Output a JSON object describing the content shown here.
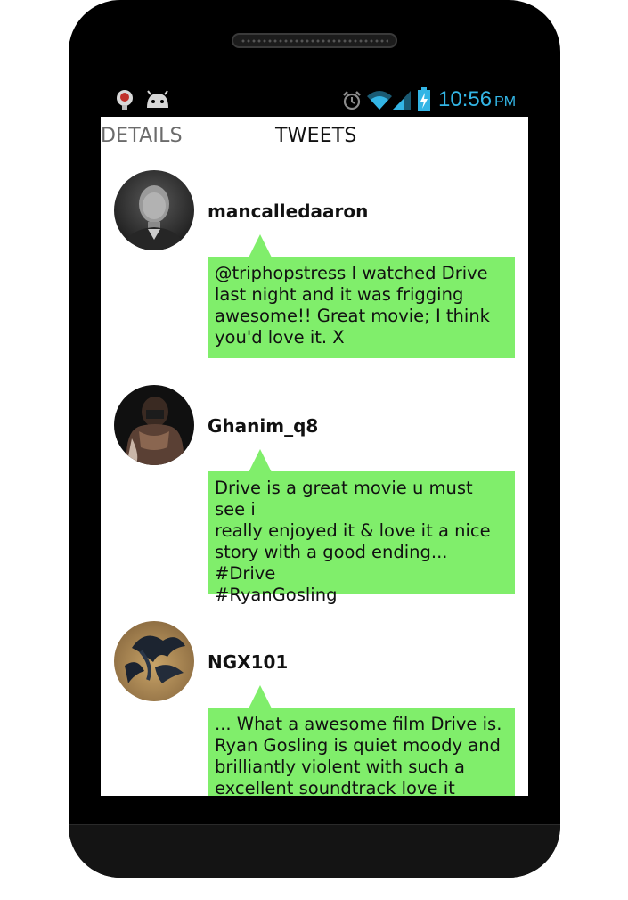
{
  "status_bar": {
    "left_icons": [
      "notification-app-icon",
      "android-debug-icon"
    ],
    "right_icons": [
      "alarm-icon",
      "wifi-icon",
      "signal-icon",
      "battery-charging-icon"
    ],
    "time": "10:56",
    "ampm": "PM",
    "accent_color": "#33b5e5"
  },
  "tabs": [
    {
      "label": "DETAILS"
    },
    {
      "label": "TWEETS"
    }
  ],
  "tweets": [
    {
      "username": "mancalledaaron",
      "text": "@triphopstress I watched Drive\nlast night and it was frigging\nawesome!! Great movie; I think\nyou'd love it. X"
    },
    {
      "username": "Ghanim_q8",
      "text": "Drive is a great movie u must see i\nreally enjoyed it & love it a nice\nstory with a good ending...\n#Drive\n#RyanGosling"
    },
    {
      "username": "NGX101",
      "text": "... What a awesome film Drive is.\nRyan Gosling is quiet moody and\nbrilliantly violent with such a\nexcellent soundtrack love it"
    }
  ],
  "colors": {
    "bubble": "#80ee6b",
    "phone_body": "#000000"
  }
}
